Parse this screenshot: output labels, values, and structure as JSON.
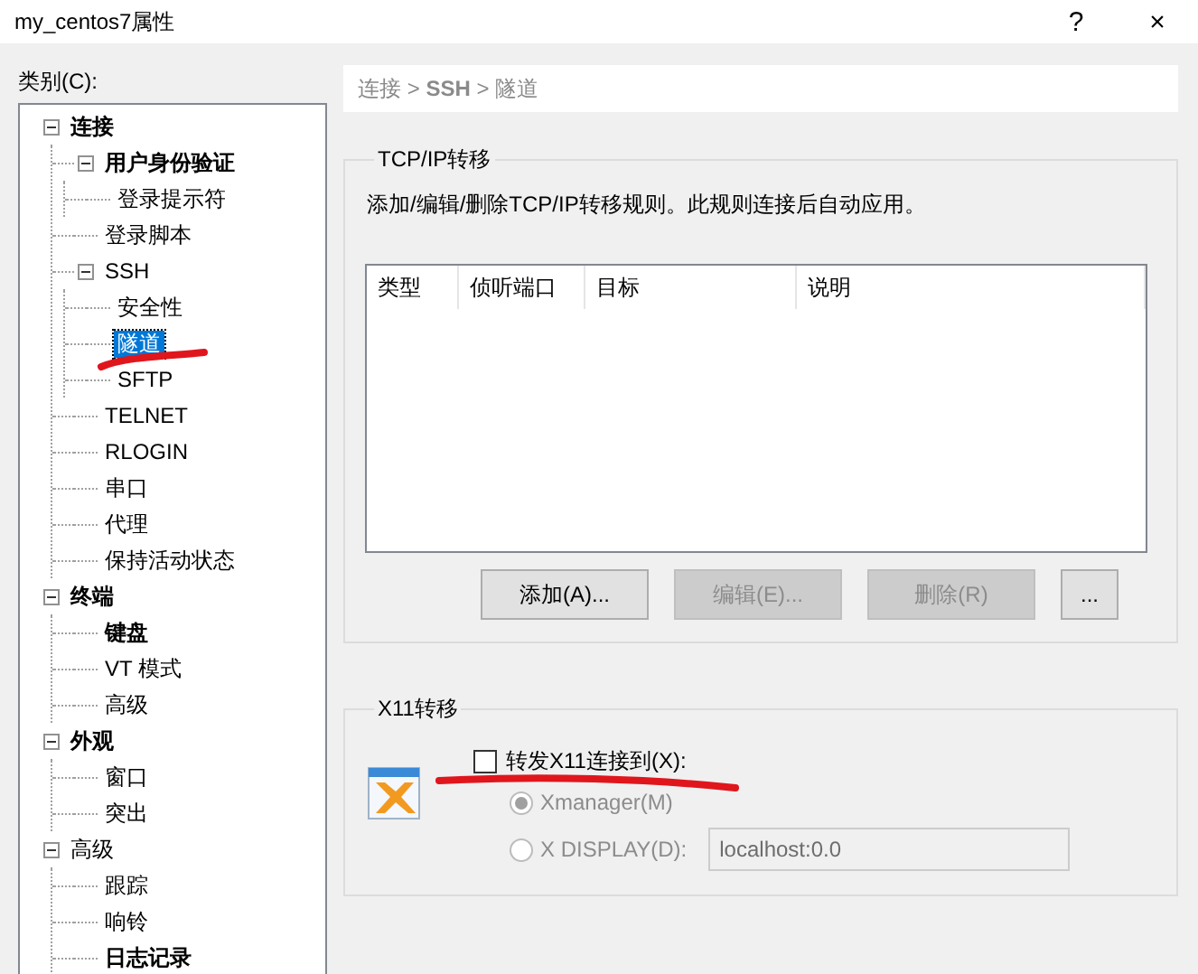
{
  "window": {
    "title": "my_centos7属性",
    "buttons": [
      "?",
      "×"
    ]
  },
  "category_label": "类别(C):",
  "tree": [
    {
      "label": "连接",
      "bold": true,
      "expanded": true,
      "selected": false,
      "children": [
        {
          "label": "用户身份验证",
          "bold": true,
          "expanded": true,
          "selected": false,
          "children": [
            {
              "label": "登录提示符",
              "bold": false,
              "selected": false
            }
          ]
        },
        {
          "label": "登录脚本",
          "bold": false,
          "selected": false
        },
        {
          "label": "SSH",
          "bold": false,
          "expanded": true,
          "selected": false,
          "children": [
            {
              "label": "安全性",
              "bold": false,
              "selected": false
            },
            {
              "label": "隧道",
              "bold": false,
              "selected": true
            },
            {
              "label": "SFTP",
              "bold": false,
              "selected": false
            }
          ]
        },
        {
          "label": "TELNET",
          "bold": false,
          "selected": false
        },
        {
          "label": "RLOGIN",
          "bold": false,
          "selected": false
        },
        {
          "label": "串口",
          "bold": false,
          "selected": false
        },
        {
          "label": "代理",
          "bold": false,
          "selected": false
        },
        {
          "label": "保持活动状态",
          "bold": false,
          "selected": false
        }
      ]
    },
    {
      "label": "终端",
      "bold": true,
      "expanded": true,
      "selected": false,
      "children": [
        {
          "label": "键盘",
          "bold": true,
          "selected": false
        },
        {
          "label": "VT 模式",
          "bold": false,
          "selected": false
        },
        {
          "label": "高级",
          "bold": false,
          "selected": false
        }
      ]
    },
    {
      "label": "外观",
      "bold": true,
      "expanded": true,
      "selected": false,
      "children": [
        {
          "label": "窗口",
          "bold": false,
          "selected": false
        },
        {
          "label": "突出",
          "bold": false,
          "selected": false
        }
      ]
    },
    {
      "label": "高级",
      "bold": false,
      "expanded": true,
      "selected": false,
      "children": [
        {
          "label": "跟踪",
          "bold": false,
          "selected": false
        },
        {
          "label": "响铃",
          "bold": false,
          "selected": false
        },
        {
          "label": "日志记录",
          "bold": true,
          "selected": false
        }
      ]
    }
  ],
  "breadcrumb": "连接 > **SSH** > 隧道",
  "tcp_group": {
    "title": "TCP/IP转移",
    "description": "添加/编辑/删除TCP/IP转移规则。此规则连接后自动应用。",
    "table": {
      "columns": [
        "类型",
        "侦听端口",
        "目标",
        "说明"
      ]
    },
    "buttons": [
      {
        "label": "添加(A)...",
        "disabled": false
      },
      {
        "label": "编辑(E)...",
        "disabled": true
      },
      {
        "label": "删除(R)",
        "disabled": true
      },
      {
        "label": "...",
        "disabled": false
      }
    ]
  },
  "x11_group": {
    "title": "X11转移",
    "forward": {
      "label": "转发X11连接到(X):",
      "checked": false
    },
    "options": [
      {
        "label": "Xmanager(M)",
        "selected": true,
        "disabled": true
      },
      {
        "label": "X DISPLAY(D):",
        "selected": false,
        "disabled": true
      }
    ],
    "display_field": {
      "value": "localhost:0.0",
      "disabled": true
    }
  }
}
